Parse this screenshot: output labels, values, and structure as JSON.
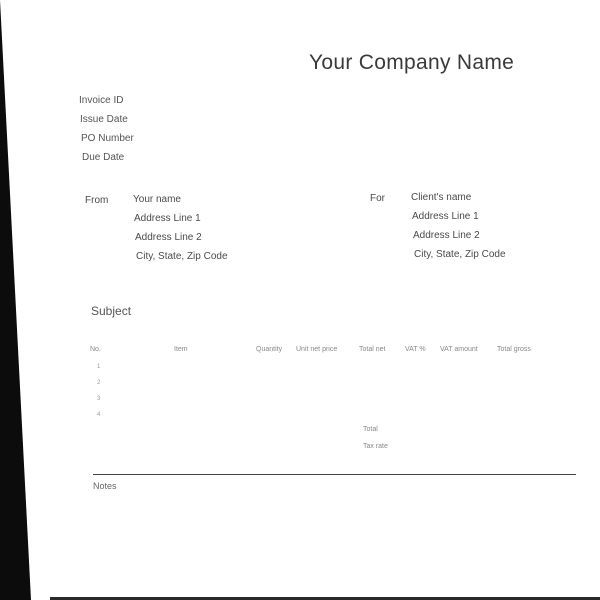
{
  "header": {
    "company_name": "Your Company Name"
  },
  "invoice_meta": {
    "invoice_id_label": "Invoice ID",
    "issue_date_label": "Issue Date",
    "po_number_label": "PO Number",
    "due_date_label": "Due Date"
  },
  "from": {
    "label": "From",
    "name": "Your name",
    "address_line_1": "Address Line 1",
    "address_line_2": "Address Line 2",
    "city_state_zip": "City, State, Zip Code"
  },
  "for": {
    "label": "For",
    "name": "Client's name",
    "address_line_1": "Address Line 1",
    "address_line_2": "Address Line 2",
    "city_state_zip": "City, State, Zip Code"
  },
  "subject": {
    "label": "Subject"
  },
  "items_table": {
    "columns": [
      "No.",
      "Item",
      "Quantity",
      "Unit net price",
      "Total net",
      "VAT %",
      "VAT amount",
      "Total gross"
    ],
    "row_numbers": [
      "1",
      "2",
      "3",
      "4"
    ]
  },
  "summary": {
    "total_label": "Total",
    "tax_rate_label": "Tax rate"
  },
  "notes": {
    "label": "Notes"
  }
}
